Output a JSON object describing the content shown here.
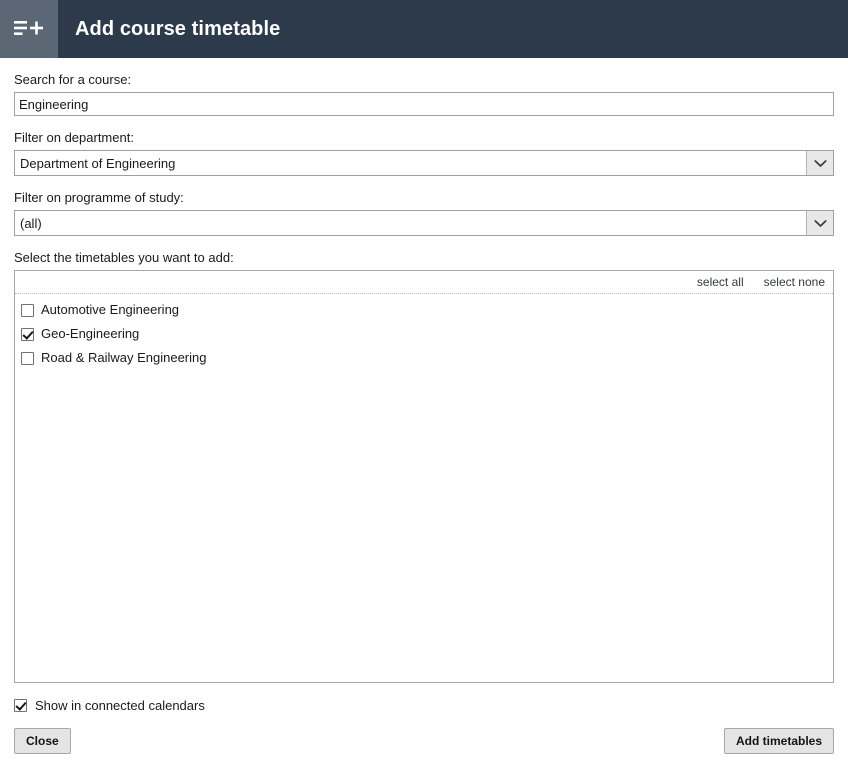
{
  "header": {
    "icon": "list-plus-icon",
    "title": "Add course timetable",
    "background_color": "#2c3a4b",
    "icon_background_color": "#5b6774"
  },
  "form": {
    "search": {
      "label": "Search for a course:",
      "value": "Engineering",
      "placeholder": ""
    },
    "department": {
      "label": "Filter on department:",
      "value": "Department of Engineering",
      "arrow_icon": "chevron-down-icon"
    },
    "programme": {
      "label": "Filter on programme of study:",
      "value": "(all)",
      "arrow_icon": "chevron-down-icon"
    },
    "timetables": {
      "label": "Select the timetables you want to add:",
      "select_all_label": "select all",
      "select_none_label": "select none",
      "items": [
        {
          "label": "Automotive Engineering",
          "checked": false
        },
        {
          "label": "Geo-Engineering",
          "checked": true
        },
        {
          "label": "Road & Railway Engineering",
          "checked": false
        }
      ]
    }
  },
  "footer": {
    "show_in_connected_calendars": {
      "label": "Show in connected calendars",
      "checked": true
    },
    "close_label": "Close",
    "add_timetables_label": "Add timetables"
  }
}
